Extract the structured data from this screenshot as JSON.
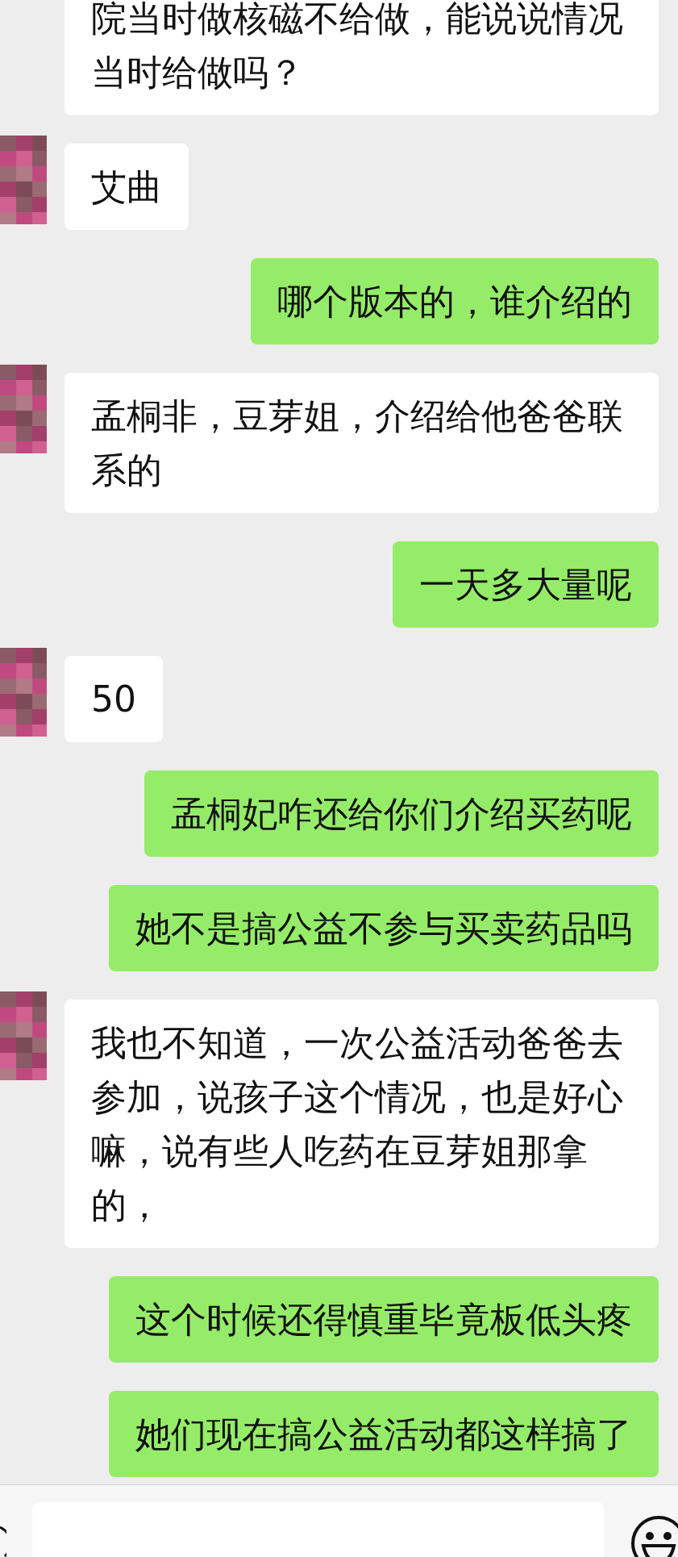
{
  "messages": [
    {
      "kind": "received",
      "show_avatar": false,
      "text": "院当时做核磁不给做，能说说情况当时给做吗？"
    },
    {
      "kind": "received",
      "show_avatar": true,
      "text": "艾曲"
    },
    {
      "kind": "sent",
      "text": "哪个版本的，谁介绍的"
    },
    {
      "kind": "received",
      "show_avatar": true,
      "text": "孟桐非，豆芽姐，介绍给他爸爸联系的"
    },
    {
      "kind": "sent",
      "text": "一天多大量呢"
    },
    {
      "kind": "received",
      "show_avatar": true,
      "text": "50"
    },
    {
      "kind": "sent",
      "text": "孟桐妃咋还给你们介绍买药呢"
    },
    {
      "kind": "sent",
      "text": "她不是搞公益不参与买卖药品吗"
    },
    {
      "kind": "received",
      "show_avatar": true,
      "text": "我也不知道，一次公益活动爸爸去参加，说孩子这个情况，也是好心嘛，说有些人吃药在豆芽姐那拿的，"
    },
    {
      "kind": "sent",
      "text": "这个时候还得慎重毕竟板低头疼"
    },
    {
      "kind": "sent",
      "text": "她们现在搞公益活动都这样搞了"
    }
  ]
}
